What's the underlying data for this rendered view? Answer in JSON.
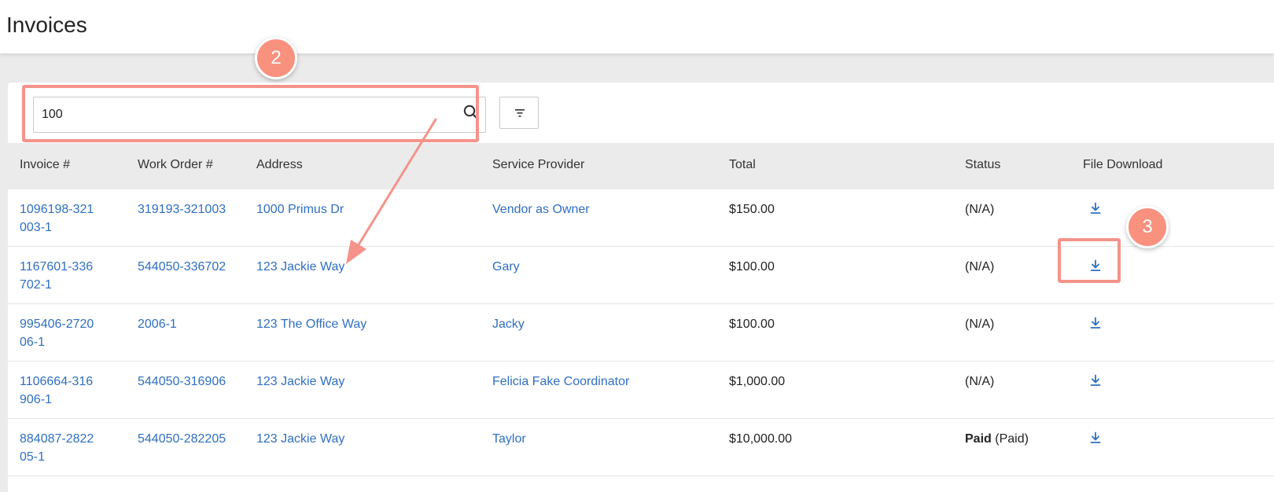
{
  "page": {
    "title": "Invoices"
  },
  "search": {
    "value": "100",
    "placeholder": ""
  },
  "table": {
    "columns": [
      "Invoice #",
      "Work Order #",
      "Address",
      "Service Provider",
      "Total",
      "Status",
      "File Download"
    ],
    "rows": [
      {
        "invoice": "1096198-321003-1",
        "work_order": "319193-321003",
        "address": "1000 Primus Dr",
        "provider": "Vendor as Owner",
        "total": "$150.00",
        "status_bold": "",
        "status": "(N/A)"
      },
      {
        "invoice": "1167601-336702-1",
        "work_order": "544050-336702",
        "address": "123 Jackie Way",
        "provider": "Gary",
        "total": "$100.00",
        "status_bold": "",
        "status": "(N/A)"
      },
      {
        "invoice": "995406-272006-1",
        "work_order": "2006-1",
        "address": "123 The Office Way",
        "provider": "Jacky",
        "total": "$100.00",
        "status_bold": "",
        "status": "(N/A)"
      },
      {
        "invoice": "1106664-316906-1",
        "work_order": "544050-316906",
        "address": "123 Jackie Way",
        "provider": "Felicia Fake Coordinator",
        "total": "$1,000.00",
        "status_bold": "",
        "status": "(N/A)"
      },
      {
        "invoice": "884087-282205-1",
        "work_order": "544050-282205",
        "address": "123 Jackie Way",
        "provider": "Taylor",
        "total": "$10,000.00",
        "status_bold": "Paid",
        "status": "(Paid)"
      }
    ]
  },
  "annotations": {
    "step2": "2",
    "step3": "3"
  },
  "colors": {
    "link": "#2f6fc1",
    "annotation": "#f5938a",
    "header_bg": "#ebebeb"
  },
  "icons": {
    "search": "search-icon",
    "filter": "filter-icon",
    "download": "download-icon"
  }
}
